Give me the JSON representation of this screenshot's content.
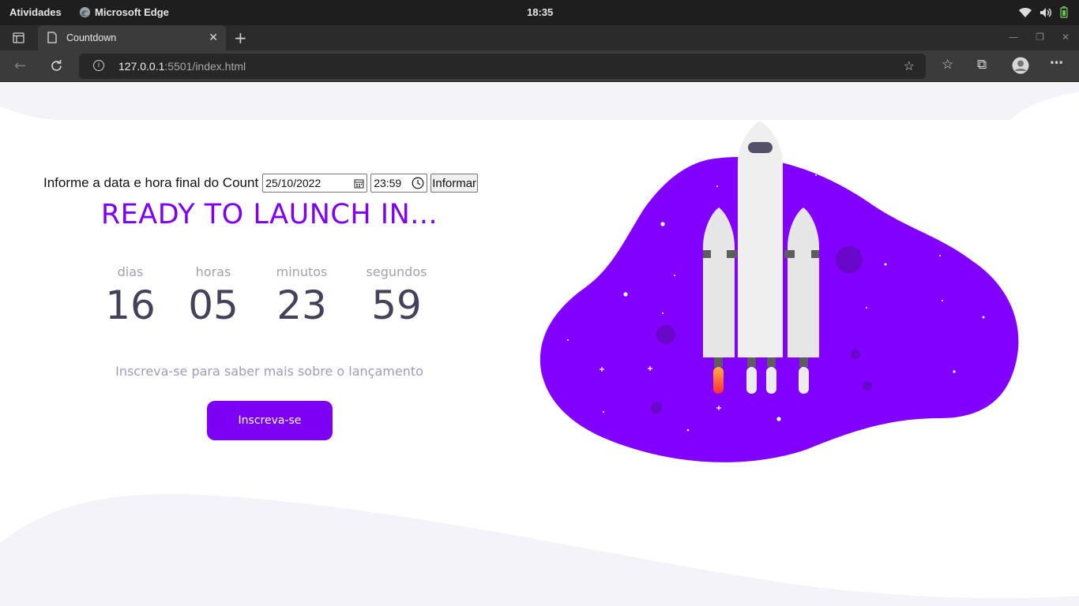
{
  "system": {
    "activities": "Atividades",
    "app_name": "Microsoft Edge",
    "clock": "18:35"
  },
  "browser": {
    "tab_title": "Countdown",
    "url_host": "127.0.0.1",
    "url_rest": ":5501/index.html"
  },
  "form": {
    "label": "Informe a data e hora final do Count",
    "date_value": "25/10/2022",
    "time_value": "23:59",
    "button_label": "Informar"
  },
  "headline": "READY TO LAUNCH IN...",
  "countdown": [
    {
      "unit": "dias",
      "value": "16"
    },
    {
      "unit": "horas",
      "value": "05"
    },
    {
      "unit": "minutos",
      "value": "23"
    },
    {
      "unit": "segundos",
      "value": "59"
    }
  ],
  "subtitle": "Inscreva-se para saber mais sobre o lançamento",
  "cta_label": "Inscreva-se",
  "colors": {
    "accent": "#7d00f5",
    "text_dark": "#44425a",
    "text_muted": "#a39fb4",
    "wave": "#f4f3fa"
  },
  "icons": {
    "calendar": "calendar-icon",
    "clock": "clock-icon",
    "rocket": "rocket-illustration"
  }
}
